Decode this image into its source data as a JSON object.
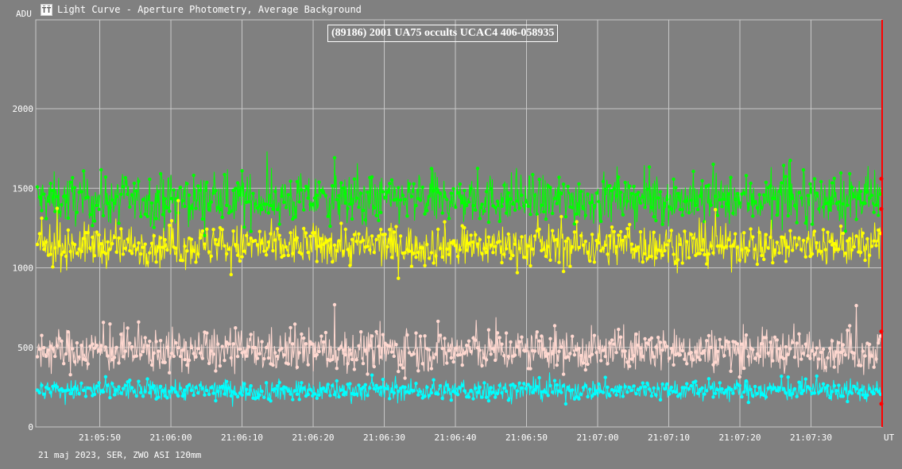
{
  "window": {
    "title": "Light Curve - Aperture Photometry, Average Background",
    "icon": "light-curve-app-icon"
  },
  "footer": "21 maj 2023, SER, ZWO ASI 120mm",
  "chart_data": {
    "type": "line",
    "title": "(89186) 2001 UA75 occults UCAC4 406-058935",
    "ylabel": "ADU",
    "xlabel": "UT",
    "ylim": [
      0,
      2000
    ],
    "yticks": [
      0,
      500,
      1000,
      1500,
      2000
    ],
    "xticks": [
      "21:05:50",
      "21:06:00",
      "21:06:10",
      "21:06:20",
      "21:06:30",
      "21:06:40",
      "21:06:50",
      "21:07:00",
      "21:07:10",
      "21:07:20",
      "21:07:30"
    ],
    "xrange": [
      "21:05:41",
      "21:07:40"
    ],
    "grid": true,
    "colors": {
      "background": "#808080",
      "grid": "#c8c8c8",
      "cursor": "#ff0000"
    },
    "series": [
      {
        "color": "#00ff00",
        "mean": 1430,
        "spread": 130
      },
      {
        "color": "#ffff00",
        "mean": 1140,
        "spread": 110
      },
      {
        "color": "#ffd8d0",
        "mean": 480,
        "spread": 110
      },
      {
        "color": "#00ffff",
        "mean": 230,
        "spread": 55
      }
    ]
  }
}
